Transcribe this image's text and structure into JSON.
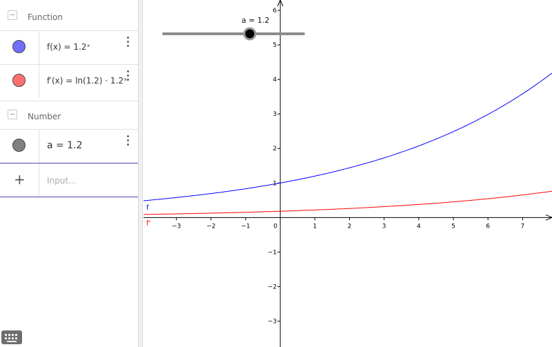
{
  "algebra": {
    "groups": [
      {
        "label": "Function"
      },
      {
        "label": "Number"
      }
    ],
    "items": [
      {
        "expr": "f(x)  =  1.2ˣ",
        "color": "#7070ff"
      },
      {
        "expr": "f′(x)  =  ln(1.2) · 1.2ˣ",
        "color": "#ff7070"
      },
      {
        "expr": "a = 1.2",
        "color": "#808080"
      }
    ],
    "input_placeholder": "Input..."
  },
  "slider": {
    "label": "a = 1.2",
    "value": 1.2
  },
  "chart_data": {
    "type": "line",
    "x_ticks": [
      "−3",
      "−2",
      "−1",
      "0",
      "1",
      "2",
      "3",
      "4",
      "5",
      "6",
      "7"
    ],
    "y_ticks": [
      "−3",
      "−2",
      "−1",
      "1",
      "2",
      "3",
      "4",
      "5",
      "6"
    ],
    "xlim": [
      -3.95,
      7.85
    ],
    "ylim": [
      -3.75,
      6.3
    ],
    "grid": false,
    "series": [
      {
        "name": "f",
        "base": 1.2,
        "coefficient": 1,
        "color": "#0000ff"
      },
      {
        "name": "f'",
        "base": 1.2,
        "coefficient": 0.1823,
        "color": "#ff0000"
      }
    ]
  }
}
